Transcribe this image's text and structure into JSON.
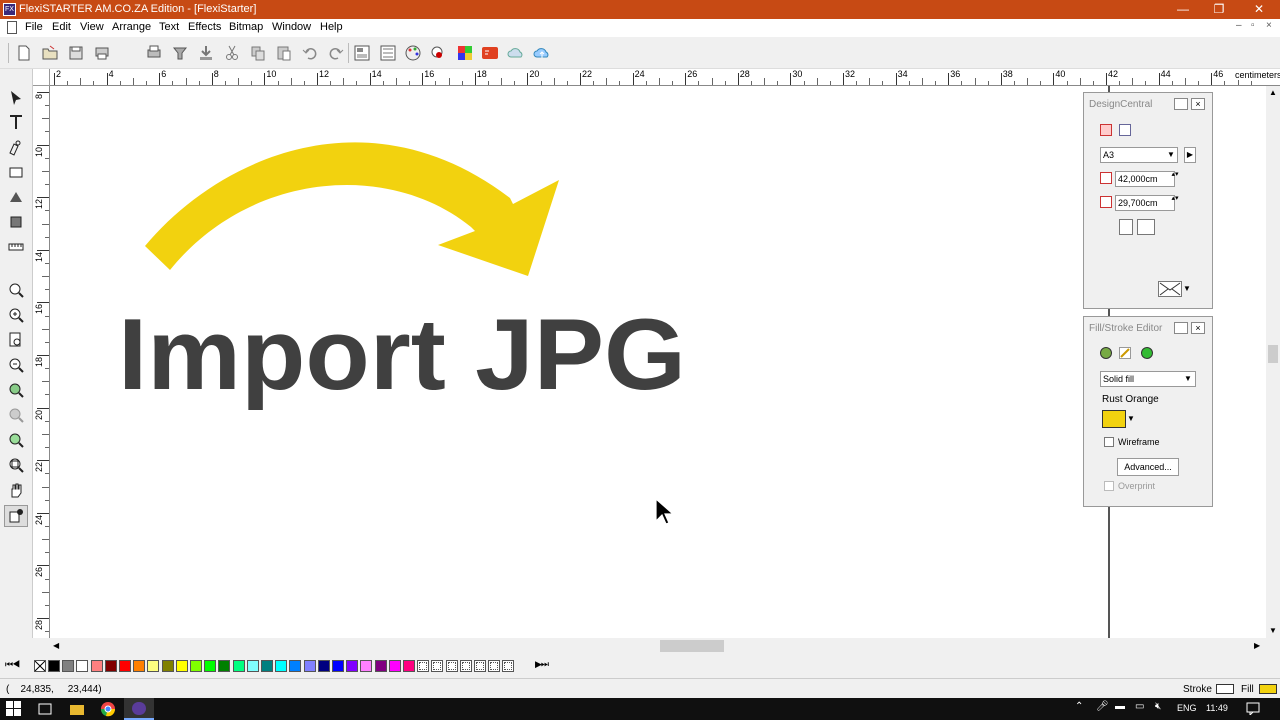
{
  "window": {
    "title": "FlexiSTARTER AM.CO.ZA Edition - [FlexiStarter]",
    "app_icon": "FX",
    "minimize": "—",
    "maximize": "❐",
    "close": "✕"
  },
  "menubar": {
    "items": [
      "File",
      "Edit",
      "View",
      "Arrange",
      "Text",
      "Effects",
      "Bitmap",
      "Window",
      "Help"
    ],
    "mdi_minimize": "–",
    "mdi_restore": "▫",
    "mdi_close": "×"
  },
  "toolbar": {
    "icons": [
      "new-icon",
      "open-icon",
      "save-icon",
      "print-setup-icon",
      "print-icon",
      "cut-contour-icon",
      "send-icon",
      "cut-icon",
      "copy-icon",
      "paste-icon",
      "undo-icon",
      "redo-icon",
      "arrange-icon",
      "design-central-icon",
      "palette-icon",
      "color-icon",
      "spot-colors-icon",
      "er-icon",
      "cloud-icon",
      "cloud-upload-icon"
    ]
  },
  "ruler": {
    "units": "centimeters",
    "h_labels": [
      "2",
      "4",
      "6",
      "8",
      "10",
      "12",
      "14",
      "16",
      "18",
      "20",
      "22",
      "24",
      "26",
      "28",
      "30",
      "32",
      "34",
      "36",
      "38",
      "40",
      "42",
      "44",
      "46"
    ],
    "v_labels": [
      "8",
      "10",
      "12",
      "14",
      "16",
      "18",
      "20",
      "22",
      "24",
      "26",
      "28"
    ]
  },
  "canvas": {
    "text": "Import JPG",
    "text_color": "#404040",
    "arrow_color": "#f2d20f"
  },
  "design_central": {
    "title": "DesignCentral",
    "page_size": "A3",
    "width": "42,000cm",
    "height": "29,700cm"
  },
  "fill_stroke": {
    "title": "Fill/Stroke Editor",
    "fill_type": "Solid fill",
    "color_name": "Rust Orange",
    "color_value": "#f2d20f",
    "wireframe_label": "Wireframe",
    "advanced_label": "Advanced...",
    "overprint_label": "Overprint"
  },
  "palette": {
    "colors": [
      "#000000",
      "#808080",
      "#ffffff",
      "#ff8080",
      "#800000",
      "#ff0000",
      "#ff8000",
      "#ffff80",
      "#808000",
      "#ffff00",
      "#80ff00",
      "#00ff00",
      "#008000",
      "#00ff80",
      "#80ffff",
      "#008080",
      "#00ffff",
      "#0080ff",
      "#8080ff",
      "#000080",
      "#0000ff",
      "#8000ff",
      "#ff80ff",
      "#800080",
      "#ff00ff",
      "#ff0080"
    ]
  },
  "status": {
    "coords": "(    24,835,     23,444)",
    "stroke_label": "Stroke",
    "fill_label": "Fill",
    "fill_color": "#f2d20f"
  },
  "taskbar": {
    "lang": "ENG",
    "time": "11:49"
  }
}
